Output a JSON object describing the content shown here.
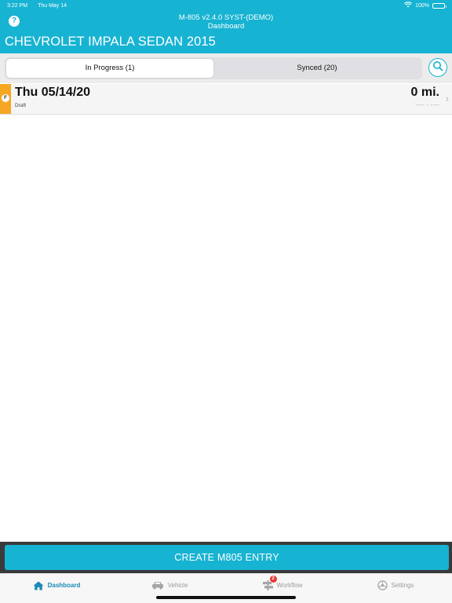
{
  "status_bar": {
    "time": "3:22 PM",
    "date": "Thu May 14",
    "battery": "100%"
  },
  "header": {
    "help_label": "?",
    "app_title": "M-805 v2.4.0 SYST-(DEMO)",
    "screen_title": "Dashboard",
    "vehicle_title": "CHEVROLET IMPALA SEDAN 2015"
  },
  "tabs_segment": {
    "items": [
      {
        "label": "In Progress (1)",
        "selected": true
      },
      {
        "label": "Synced (20)",
        "selected": false
      }
    ]
  },
  "entries": [
    {
      "flag": "F",
      "date": "Thu 05/14/20",
      "status": "Draft",
      "miles": "0 mi.",
      "time_range": "---- - ----",
      "flag_color": "#f5a623"
    }
  ],
  "create_button": {
    "label": "CREATE M805 ENTRY"
  },
  "tab_bar": {
    "items": [
      {
        "label": "Dashboard",
        "icon": "home-icon",
        "active": true
      },
      {
        "label": "Vehicle",
        "icon": "car-icon",
        "active": false
      },
      {
        "label": "Workflow",
        "icon": "workflow-icon",
        "active": false,
        "badge": "2"
      },
      {
        "label": "Settings",
        "icon": "gear-icon",
        "active": false
      }
    ]
  },
  "colors": {
    "brand": "#17b3d2",
    "accent_active": "#1a8ab5",
    "flag": "#f5a623",
    "badge": "#e53935"
  }
}
